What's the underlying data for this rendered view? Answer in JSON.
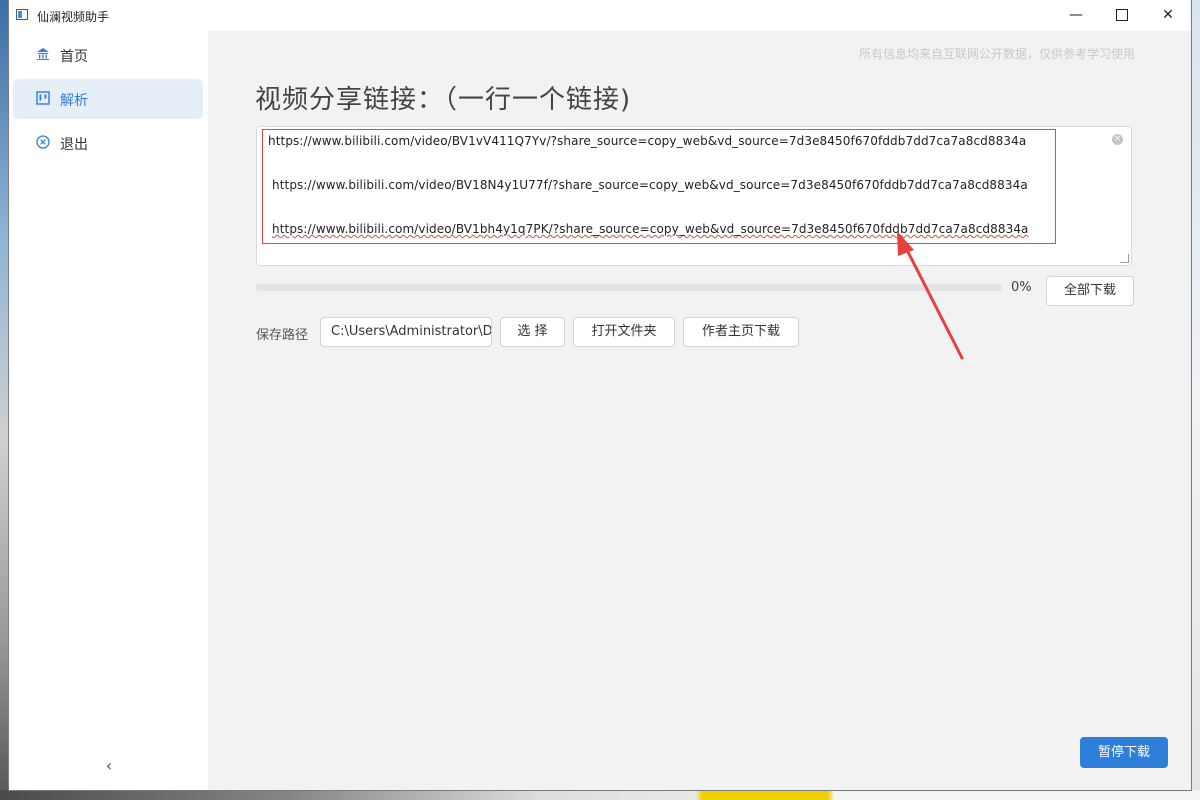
{
  "window": {
    "title": "仙澜视频助手",
    "controls": {
      "minimize": "—",
      "maximize_icon": "maximize-icon",
      "close": "✕"
    }
  },
  "sidebar": {
    "items": [
      {
        "label": "首页",
        "icon": "bank-icon",
        "active": false
      },
      {
        "label": "解析",
        "icon": "kanban-icon",
        "active": true
      },
      {
        "label": "退出",
        "icon": "close-circle-icon",
        "active": false
      }
    ],
    "collapse_icon": "‹"
  },
  "main": {
    "disclaimer": "所有信息均来自互联网公开数据，仅供参考学习使用",
    "heading": "视频分享链接：（一行一个链接)",
    "links": [
      "https://www.bilibili.com/video/BV1vV411Q7Yv/?share_source=copy_web&vd_source=7d3e8450f670fddb7dd7ca7a8cd8834a",
      " https://www.bilibili.com/video/BV18N4y1U77f/?share_source=copy_web&vd_source=7d3e8450f670fddb7dd7ca7a8cd8834a",
      " https://www.bilibili.com/video/BV1bh4y1q7PK/?share_source=copy_web&vd_source=7d3e8450f670fddb7dd7ca7a8cd8834a"
    ],
    "progress": {
      "percent": 0,
      "text": "0%"
    },
    "download_all": "全部下载",
    "save_path": {
      "label": "保存路径",
      "value": "C:\\Users\\Administrator\\Desktop"
    },
    "buttons": {
      "choose": "选 择",
      "open_folder": "打开文件夹",
      "author_download": "作者主页下载",
      "pause": "暂停下载"
    }
  },
  "colors": {
    "accent": "#2d7fd9",
    "annotation": "#e04848",
    "main_bg": "#f2f2f2"
  }
}
